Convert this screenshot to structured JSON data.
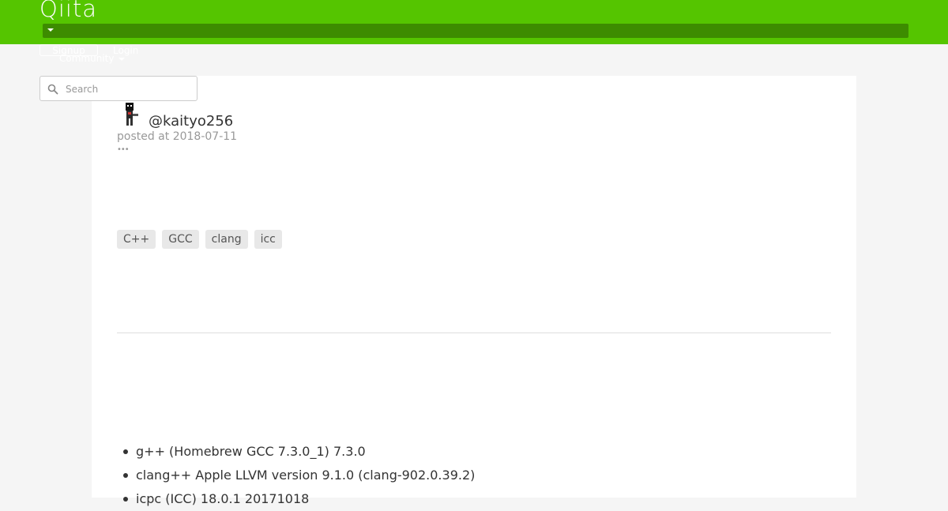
{
  "header": {
    "logo": "Qiita",
    "signup_label": "Signup",
    "login_label": "Login",
    "community_label": "Community"
  },
  "search": {
    "placeholder": "Search"
  },
  "article": {
    "author": "@kaityo256",
    "posted": "posted at 2018-07-11",
    "more_label": "•••",
    "tags": [
      "C++",
      "GCC",
      "clang",
      "icc"
    ],
    "environment": [
      "g++ (Homebrew GCC 7.3.0_1) 7.3.0",
      "clang++ Apple LLVM version 9.1.0 (clang-902.0.39.2)",
      "icpc (ICC) 18.0.1 20171018"
    ]
  },
  "colors": {
    "brand": "#55c500",
    "nav": "#3d8c00"
  }
}
